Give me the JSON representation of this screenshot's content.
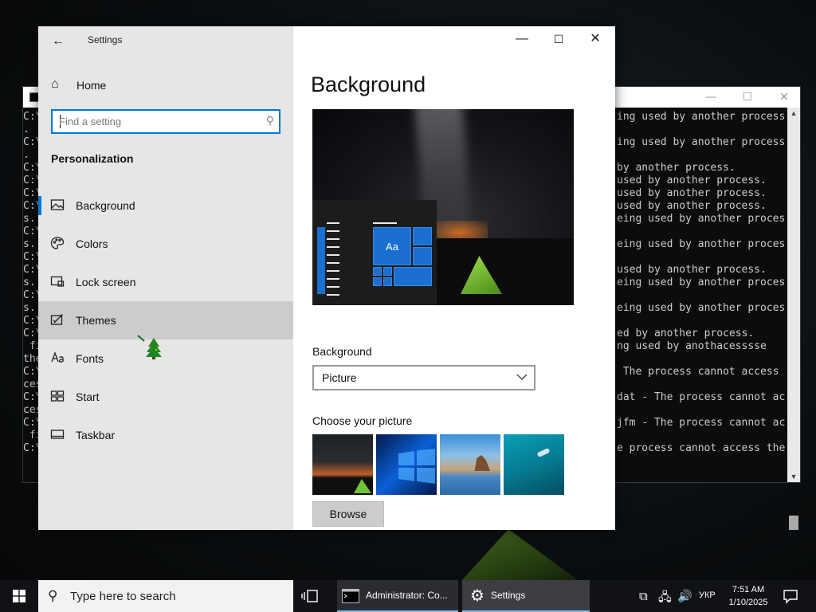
{
  "settings": {
    "title": "Settings",
    "home_label": "Home",
    "search_placeholder": "Find a setting",
    "section_title": "Personalization",
    "nav_items": [
      {
        "label": "Background"
      },
      {
        "label": "Colors"
      },
      {
        "label": "Lock screen"
      },
      {
        "label": "Themes"
      },
      {
        "label": "Fonts"
      },
      {
        "label": "Start"
      },
      {
        "label": "Taskbar"
      }
    ],
    "page_title": "Background",
    "preview_sample_text": "Aa",
    "background_label": "Background",
    "background_value": "Picture",
    "choose_picture_label": "Choose your picture",
    "browse_label": "Browse",
    "accent_color": "#0078d7"
  },
  "console": {
    "left_lines": [
      "C:\\",
      ".",
      "C:\\",
      ".",
      "C:\\",
      "C:\\",
      "C:\\",
      "C:\\",
      "s.",
      "C:\\",
      "s.",
      "C:\\",
      "C:\\",
      "s.",
      "C:\\",
      "s.",
      "C:\\",
      "C:\\",
      " fi",
      "the",
      "C:\\",
      "ces",
      "C:\\",
      "ces",
      "C:\\",
      " fi",
      "C:\\"
    ],
    "right_lines": [
      "ing used by another process",
      "",
      "ing used by another process",
      "",
      "by another process.",
      "used by another process.",
      "used by another process.",
      "used by another process.",
      "eing used by another proces",
      "",
      "eing used by another proces",
      "",
      "used by another process.",
      "eing used by another proces",
      "",
      "eing used by another proces",
      "",
      "ed by another process.",
      "ng used by anothacesssse",
      "",
      " The process cannot access",
      "",
      "dat - The process cannot ac",
      "",
      "jfm - The process cannot ac",
      "",
      "e process cannot access the"
    ]
  },
  "taskbar": {
    "search_placeholder": "Type here to search",
    "apps": [
      {
        "label": "Administrator: Co..."
      },
      {
        "label": "Settings"
      }
    ],
    "language": "УКР",
    "time": "7:51 AM",
    "date": "1/10/2025"
  }
}
